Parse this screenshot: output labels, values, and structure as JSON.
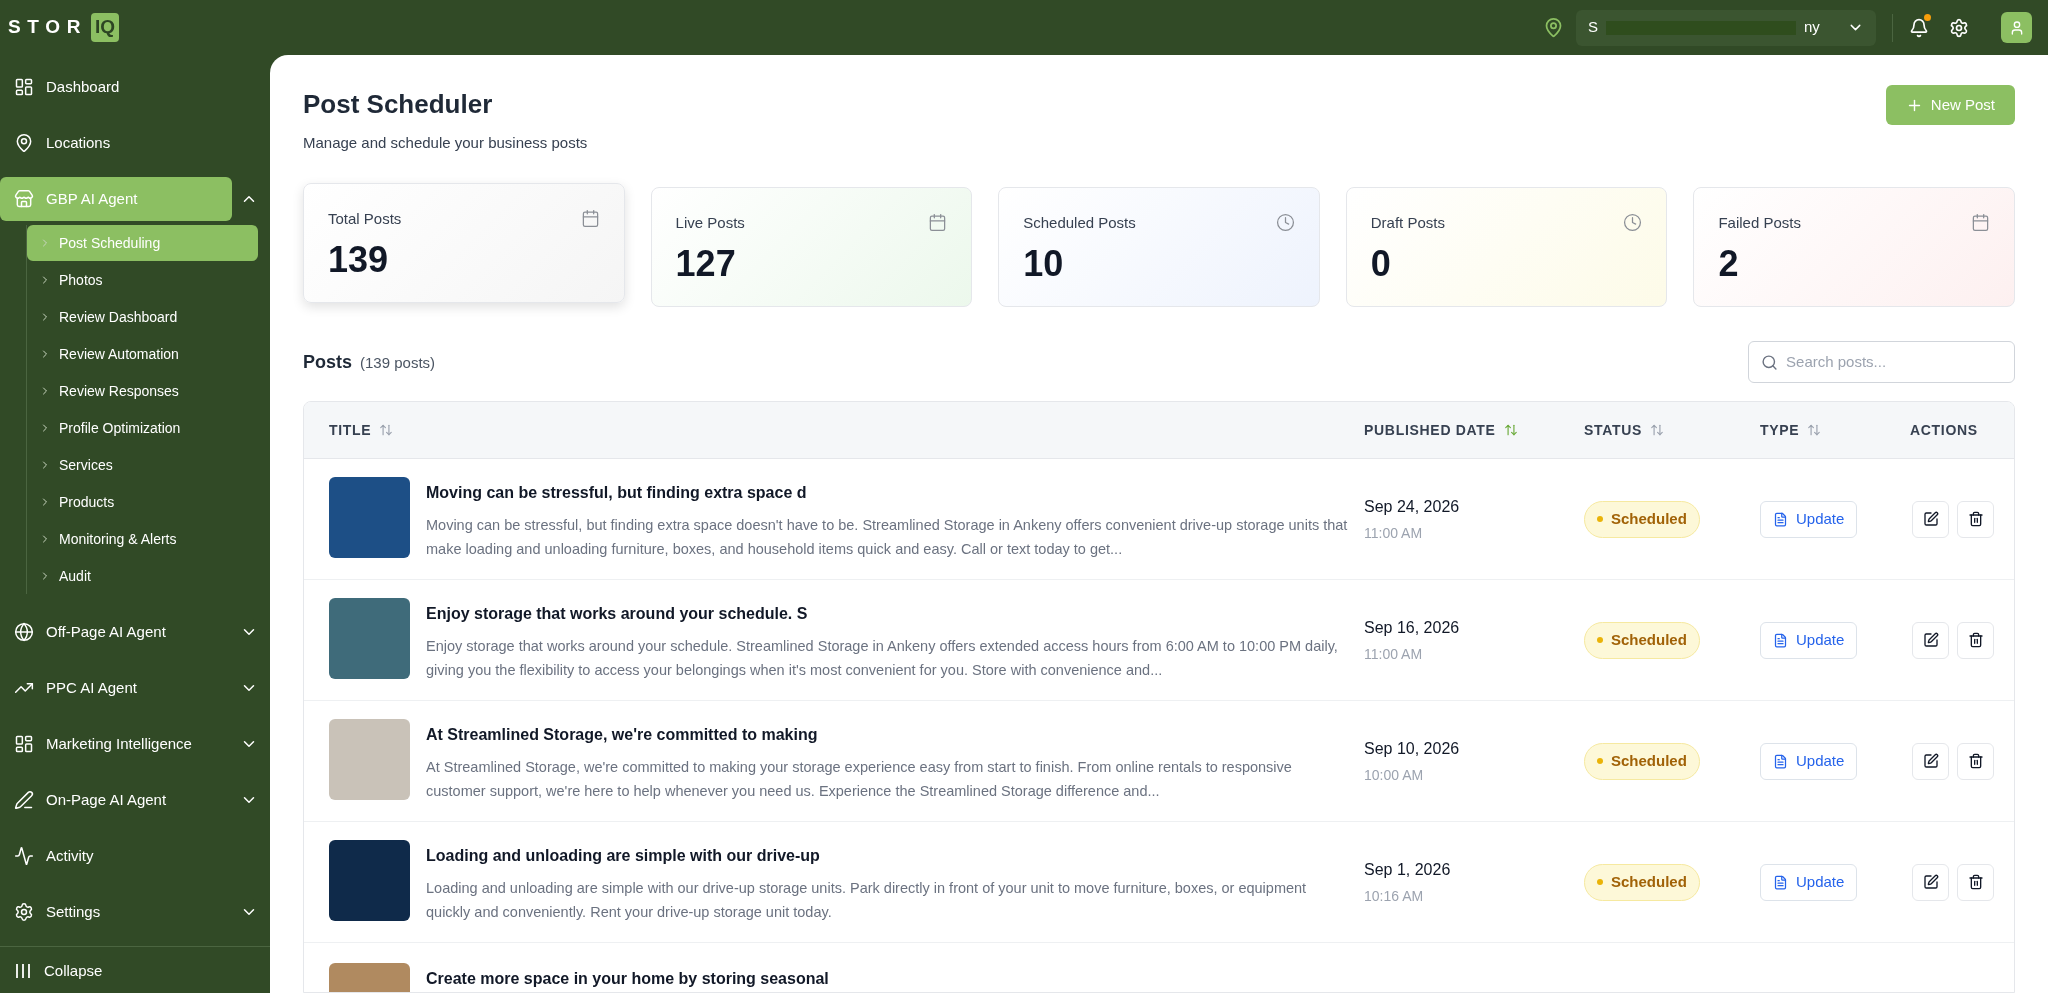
{
  "topbar": {
    "logo": {
      "text": "STOR",
      "mark": "IQ"
    },
    "location": {
      "prefix": "S",
      "suffix": "ny"
    },
    "notifications": {
      "unread": true
    }
  },
  "sidebar": {
    "items": [
      {
        "label": "Dashboard",
        "selected": false
      },
      {
        "label": "Locations",
        "selected": false
      },
      {
        "label": "GBP AI Agent",
        "selected": true,
        "expanded": true,
        "children": [
          {
            "label": "Post Scheduling",
            "selected": true
          },
          {
            "label": "Photos",
            "selected": false
          },
          {
            "label": "Review Dashboard",
            "selected": false
          },
          {
            "label": "Review Automation",
            "selected": false
          },
          {
            "label": "Review Responses",
            "selected": false
          },
          {
            "label": "Profile Optimization",
            "selected": false
          },
          {
            "label": "Services",
            "selected": false
          },
          {
            "label": "Products",
            "selected": false
          },
          {
            "label": "Monitoring & Alerts",
            "selected": false
          },
          {
            "label": "Audit",
            "selected": false
          }
        ]
      },
      {
        "label": "Off-Page AI Agent",
        "selected": false,
        "expanded": false
      },
      {
        "label": "PPC AI Agent",
        "selected": false,
        "expanded": false
      },
      {
        "label": "Marketing Intelligence",
        "selected": false,
        "expanded": false
      },
      {
        "label": "On-Page AI Agent",
        "selected": false,
        "expanded": false
      },
      {
        "label": "Activity",
        "selected": false
      },
      {
        "label": "Settings",
        "selected": false,
        "expanded": false
      }
    ],
    "collapse": "Collapse"
  },
  "page": {
    "title": "Post Scheduler",
    "subtitle": "Manage and schedule your business posts",
    "new_button": "New Post"
  },
  "stats": [
    {
      "label": "Total Posts",
      "value": "139",
      "kind": "date",
      "color": "#f5f5f5",
      "selected": true
    },
    {
      "label": "Live Posts",
      "value": "127",
      "kind": "date",
      "color": "#ecf8ec",
      "selected": false
    },
    {
      "label": "Scheduled Posts",
      "value": "10",
      "kind": "time",
      "color": "#eef3fd",
      "selected": false
    },
    {
      "label": "Draft Posts",
      "value": "0",
      "kind": "time",
      "color": "#fdfbe8",
      "selected": false
    },
    {
      "label": "Failed Posts",
      "value": "2",
      "kind": "date",
      "color": "#fdf0f0",
      "selected": false
    }
  ],
  "posts": {
    "heading": "Posts",
    "count": "(139 posts)",
    "search": {
      "placeholder": "Search posts..."
    },
    "columns": [
      {
        "label": "TITLE",
        "sorted": false
      },
      {
        "label": "PUBLISHED DATE",
        "sorted": true
      },
      {
        "label": "STATUS",
        "sorted": false
      },
      {
        "label": "TYPE",
        "sorted": false
      },
      {
        "label": "ACTIONS"
      }
    ],
    "rows": [
      {
        "title": "Moving can be stressful, but finding extra space d",
        "body": "Moving can be stressful, but finding extra space doesn't have to be. Streamlined Storage in Ankeny offers convenient drive-up storage units that make loading and unloading furniture, boxes, and household items quick and easy. Call or text today to get...",
        "date": "Sep 24, 2026",
        "time": "11:00 AM",
        "status": "Scheduled",
        "type": "Update"
      },
      {
        "title": "Enjoy storage that works around your schedule. S",
        "body": "Enjoy storage that works around your schedule. Streamlined Storage in Ankeny offers extended access hours from 6:00 AM to 10:00 PM daily, giving you the flexibility to access your belongings when it's most convenient for you. Store with convenience and...",
        "date": "Sep 16, 2026",
        "time": "11:00 AM",
        "status": "Scheduled",
        "type": "Update"
      },
      {
        "title": "At Streamlined Storage, we're committed to making",
        "body": "At Streamlined Storage, we're committed to making your storage experience easy from start to finish. From online rentals to responsive customer support, we're here to help whenever you need us. Experience the Streamlined Storage difference and...",
        "date": "Sep 10, 2026",
        "time": "10:00 AM",
        "status": "Scheduled",
        "type": "Update"
      },
      {
        "title": "Loading and unloading are simple with our drive-up",
        "body": "Loading and unloading are simple with our drive-up storage units. Park directly in front of your unit to move furniture, boxes, or equipment quickly and conveniently. Rent your drive-up storage unit today.",
        "date": "Sep 1, 2026",
        "time": "10:16 AM",
        "status": "Scheduled",
        "type": "Update"
      },
      {
        "title": "Create more space in your home by storing seasonal"
      }
    ]
  }
}
